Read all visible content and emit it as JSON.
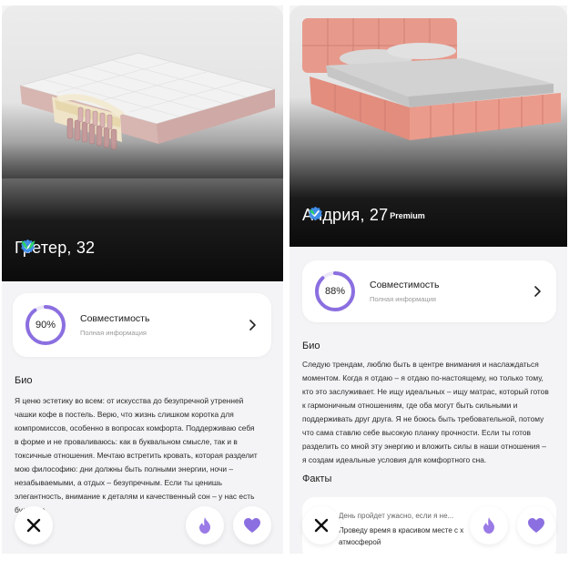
{
  "colors": {
    "accent": "#8b6fe0",
    "ring_track": "#ece8f7",
    "verified": "#3f8de8",
    "premium": "#2fd06a"
  },
  "cards": [
    {
      "name": "Гретер, 32",
      "compatibility": {
        "value": "90%",
        "percent": 90,
        "title": "Совместимость",
        "subtitle": "Полная информация"
      },
      "bio_title": "Био",
      "bio_lines": [
        "Я ценю эстетику во всем: от искусства до безупречной утренней",
        "чашки кофе в постель. Верю, что жизнь слишком коротка для",
        "компромиссов, особенно в вопросах комфорта. Поддерживаю себя",
        "в форме и не проваливаюсь: как в буквальном смысле, так и в",
        "токсичные отношения. Мечтаю встретить кровать, которая разделит",
        "мою философию: дни должны быть полными энергии, ночи –",
        "незабываемыми, а отдых – безупречным. Если ты ценишь",
        "элегантность, внимание к деталям и качественный сон – у нас есть",
        "будущее."
      ]
    },
    {
      "name": "Андрия, 27",
      "premium_label": "Premium",
      "compatibility": {
        "value": "88%",
        "percent": 88,
        "title": "Совместимость",
        "subtitle": "Полная информация"
      },
      "bio_title": "Био",
      "bio_lines": [
        "Следую трендам, люблю быть в центре внимания и наслаждаться",
        "моментом. Когда я отдаю – я отдаю по-настоящему, но только тому,",
        "кто это заслуживает. Не ищу идеальных – ищу матрас, который готов",
        "к гармоничным отношениям, где оба могут быть сильными и",
        "поддерживать друг друга. Я не боюсь быть требовательной, потому",
        "что сама ставлю себе высокую планку прочности. Если ты готов",
        "разделить со мной эту энергию и вложить силы в наши отношения –",
        "я создам идеальные условия для комфортного сна."
      ],
      "facts_title": "Факты",
      "facts": [
        "День пройдет ужасно, если я не...",
        "Проведу время в красивом месте с х",
        "атмосферой"
      ]
    }
  ],
  "icons": {
    "dislike": "close-icon",
    "superlike": "flame-icon",
    "like": "heart-icon"
  }
}
